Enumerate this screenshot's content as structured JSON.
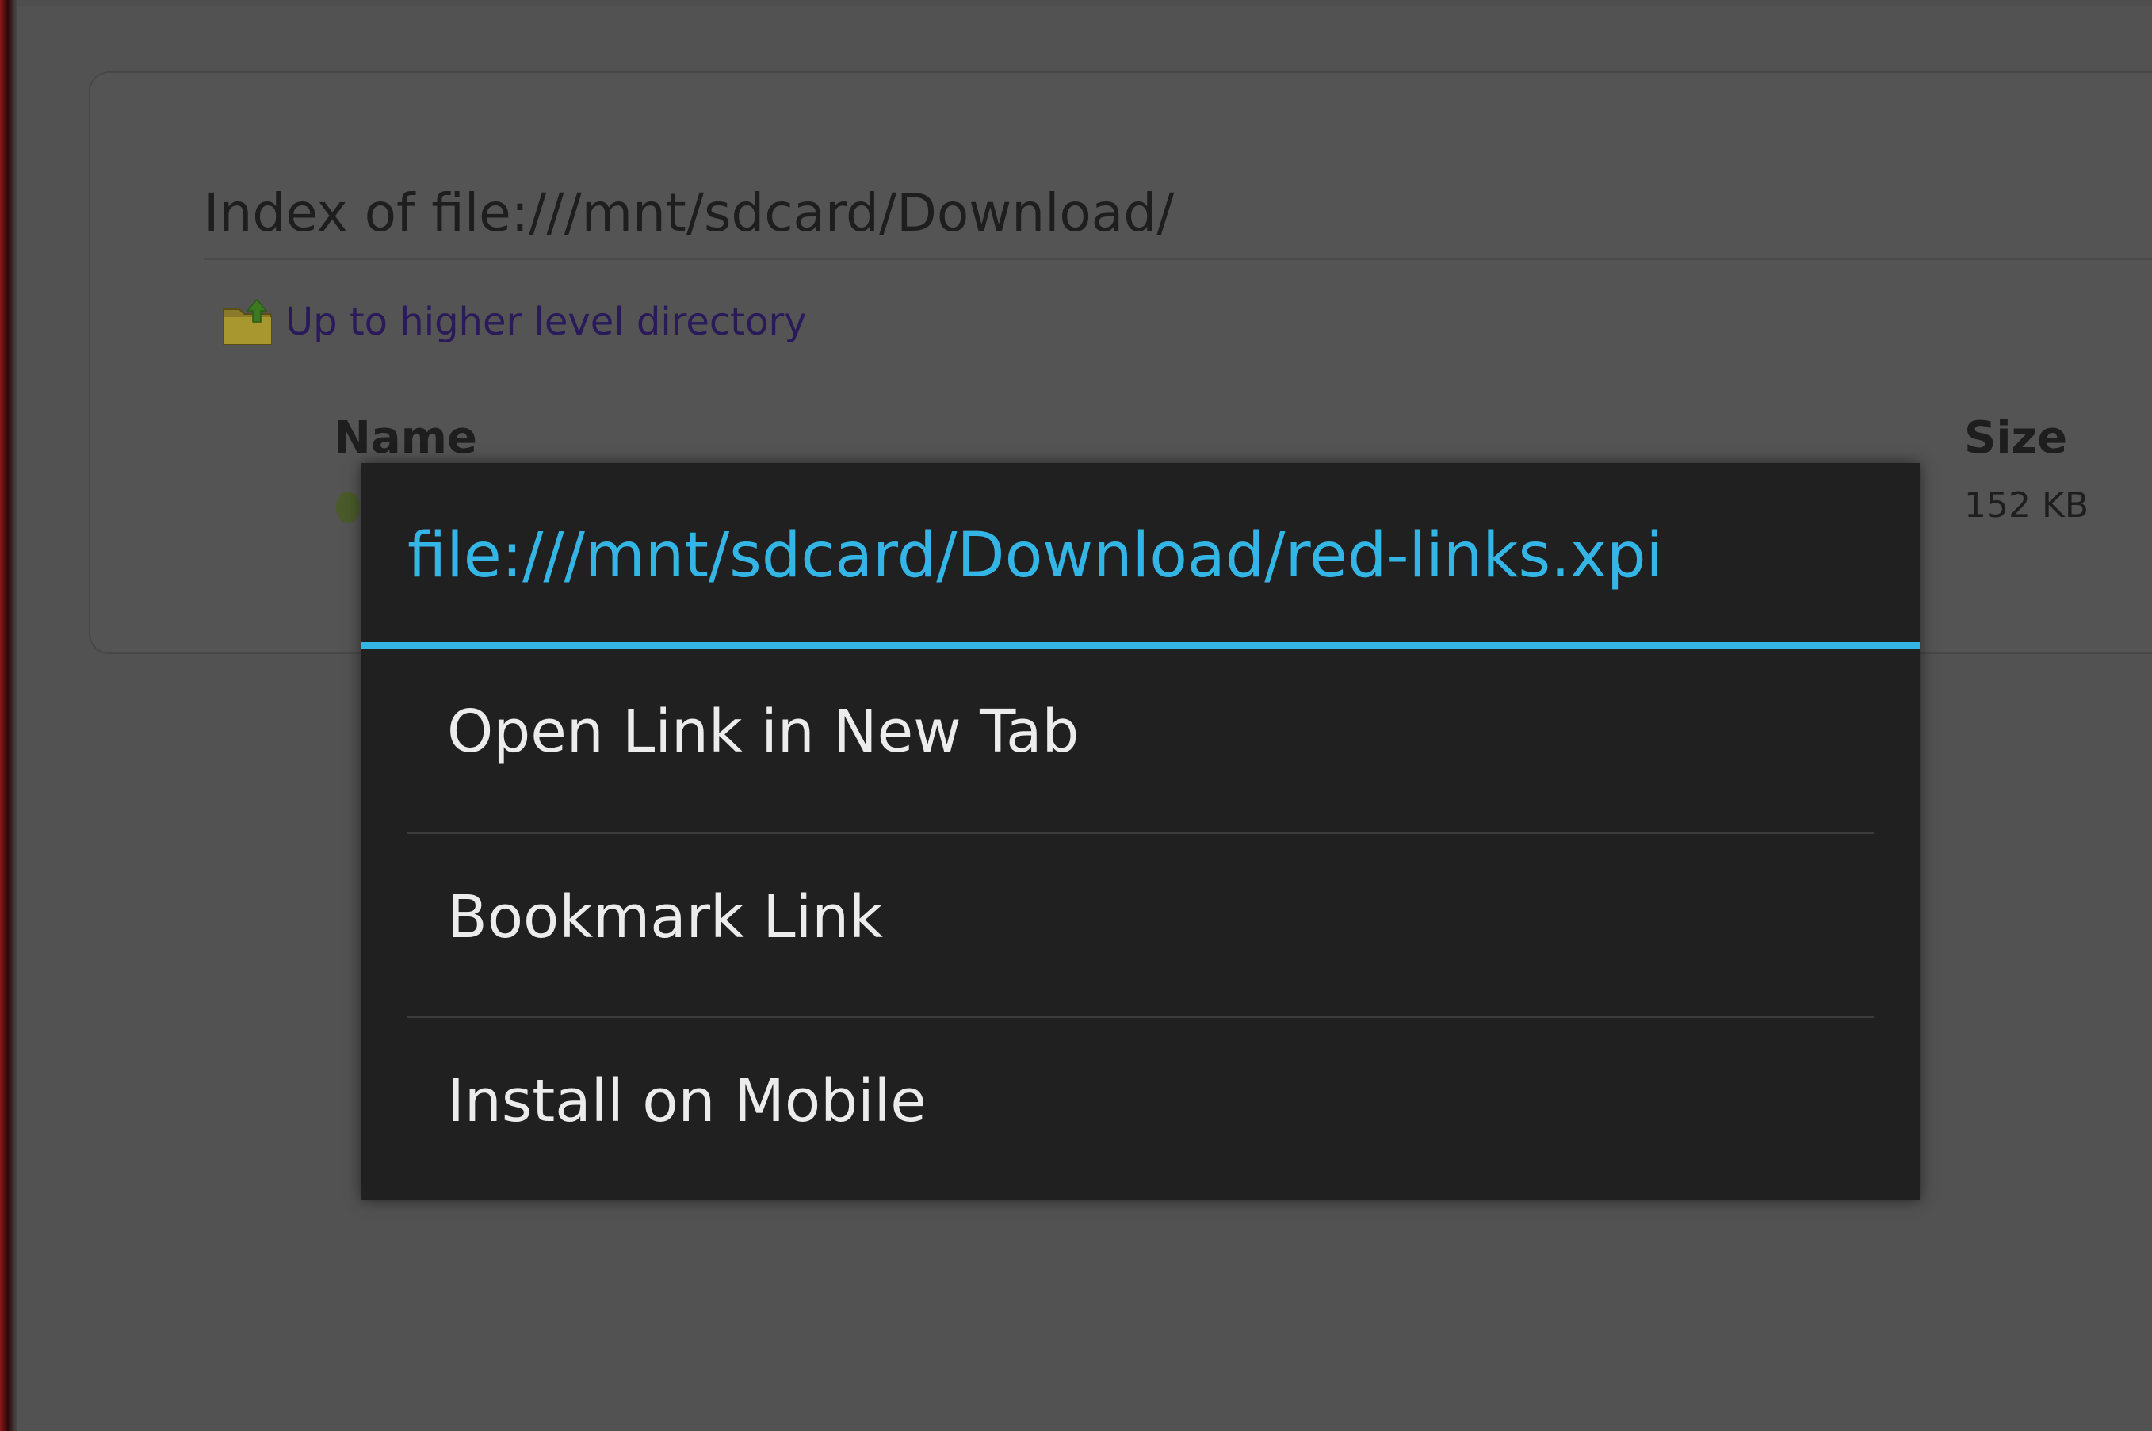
{
  "page": {
    "title": "Index of file:///mnt/sdcard/Download/",
    "up_link": "Up to higher level directory",
    "columns": {
      "name": "Name",
      "size": "Size"
    },
    "rows": [
      {
        "size": "152 KB"
      }
    ]
  },
  "context_menu": {
    "url": "file:///mnt/sdcard/Download/red-links.xpi",
    "items": [
      {
        "label": "Open Link in New Tab"
      },
      {
        "label": "Bookmark Link"
      },
      {
        "label": "Install on Mobile"
      }
    ]
  },
  "colors": {
    "accent": "#33b5e5",
    "menu_background": "#202020",
    "dimmed_page": "#525252",
    "link": "#2a1a5a"
  },
  "icons": {
    "up_directory": "folder-up-icon"
  }
}
